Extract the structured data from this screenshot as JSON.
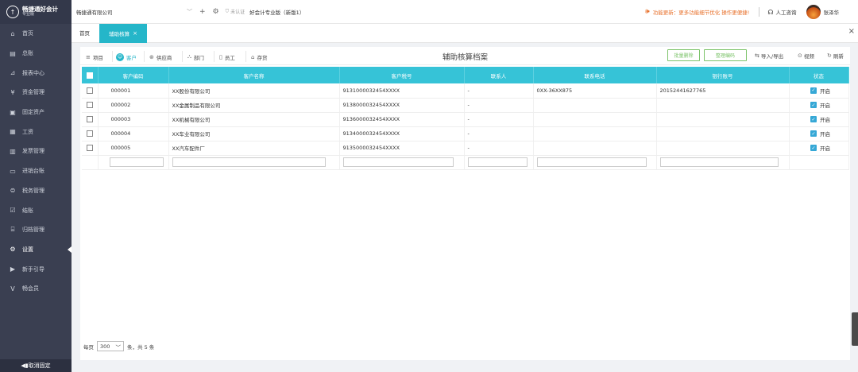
{
  "brand": {
    "name": "畅捷通好会计",
    "edition": "专业版",
    "logo_icon": "upload-cloud-icon"
  },
  "sidebar": {
    "items": [
      {
        "label": "首页",
        "icon": "home-icon"
      },
      {
        "label": "总账",
        "icon": "ledger-icon"
      },
      {
        "label": "报表中心",
        "icon": "report-icon"
      },
      {
        "label": "资金管理",
        "icon": "fund-icon"
      },
      {
        "label": "固定资产",
        "icon": "asset-icon"
      },
      {
        "label": "工资",
        "icon": "salary-icon"
      },
      {
        "label": "发票管理",
        "icon": "invoice-icon"
      },
      {
        "label": "进销台账",
        "icon": "inventory-icon"
      },
      {
        "label": "税务管理",
        "icon": "tax-icon"
      },
      {
        "label": "结账",
        "icon": "close-period-icon"
      },
      {
        "label": "归档管理",
        "icon": "archive-icon"
      },
      {
        "label": "设置",
        "icon": "gear-icon"
      },
      {
        "label": "新手引导",
        "icon": "guide-icon"
      },
      {
        "label": "畅会员",
        "icon": "vip-icon"
      }
    ],
    "active_index": 11,
    "footer_label": "◀▮取消固定"
  },
  "topbar": {
    "company": "畅捷通有限公司",
    "cert_status": "未认证",
    "product": "好会计专业版（新版1）",
    "notice": "功能更新：更多功能细节优化 操作更便捷!",
    "support": "人工咨询",
    "username": "张泽华",
    "accent_color": "#e8712c"
  },
  "tabs": {
    "home": "首页",
    "active": "辅助核算",
    "close": "×"
  },
  "toolbar": {
    "categories": [
      {
        "label": "项目",
        "icon": "list-icon"
      },
      {
        "label": "客户",
        "icon": "customer-icon"
      },
      {
        "label": "供应商",
        "icon": "supplier-icon"
      },
      {
        "label": "部门",
        "icon": "department-icon"
      },
      {
        "label": "员工",
        "icon": "employee-icon"
      },
      {
        "label": "存货",
        "icon": "stock-icon"
      }
    ],
    "active_category": 1,
    "title": "辅助核算档案",
    "batch_delete": "批量删除",
    "reorder_codes": "整理编码",
    "import_export": "导入/导出",
    "video": "视频",
    "refresh": "刷新",
    "accent_color": "#25b6c9",
    "button_color": "#7cc36a"
  },
  "table": {
    "headers": [
      "",
      "客户编码",
      "客户名称",
      "客户税号",
      "联系人",
      "联系电话",
      "银行账号",
      "状态"
    ],
    "header_color": "#36c3d7",
    "rows": [
      {
        "code": "000001",
        "name": "XX股份有限公司",
        "tax_id": "9131000032454XXXX",
        "contact": "-",
        "phone": "0XX-36XX875",
        "bank": "20152441627765",
        "status": "开启"
      },
      {
        "code": "000002",
        "name": "XX金属制品有限公司",
        "tax_id": "9138000032454XXXX",
        "contact": "-",
        "phone": "",
        "bank": "",
        "status": "开启"
      },
      {
        "code": "000003",
        "name": "XX机械有限公司",
        "tax_id": "9136000032454XXXX",
        "contact": "-",
        "phone": "",
        "bank": "",
        "status": "开启"
      },
      {
        "code": "000004",
        "name": "XX车业有限公司",
        "tax_id": "9134000032454XXXX",
        "contact": "-",
        "phone": "",
        "bank": "",
        "status": "开启"
      },
      {
        "code": "000005",
        "name": "XX汽车配件厂",
        "tax_id": "9135000032454XXXX",
        "contact": "-",
        "phone": "",
        "bank": "",
        "status": "开启"
      }
    ]
  },
  "pager": {
    "per_page_label": "每页",
    "per_page_value": "300",
    "summary": "条，共 5 条"
  }
}
